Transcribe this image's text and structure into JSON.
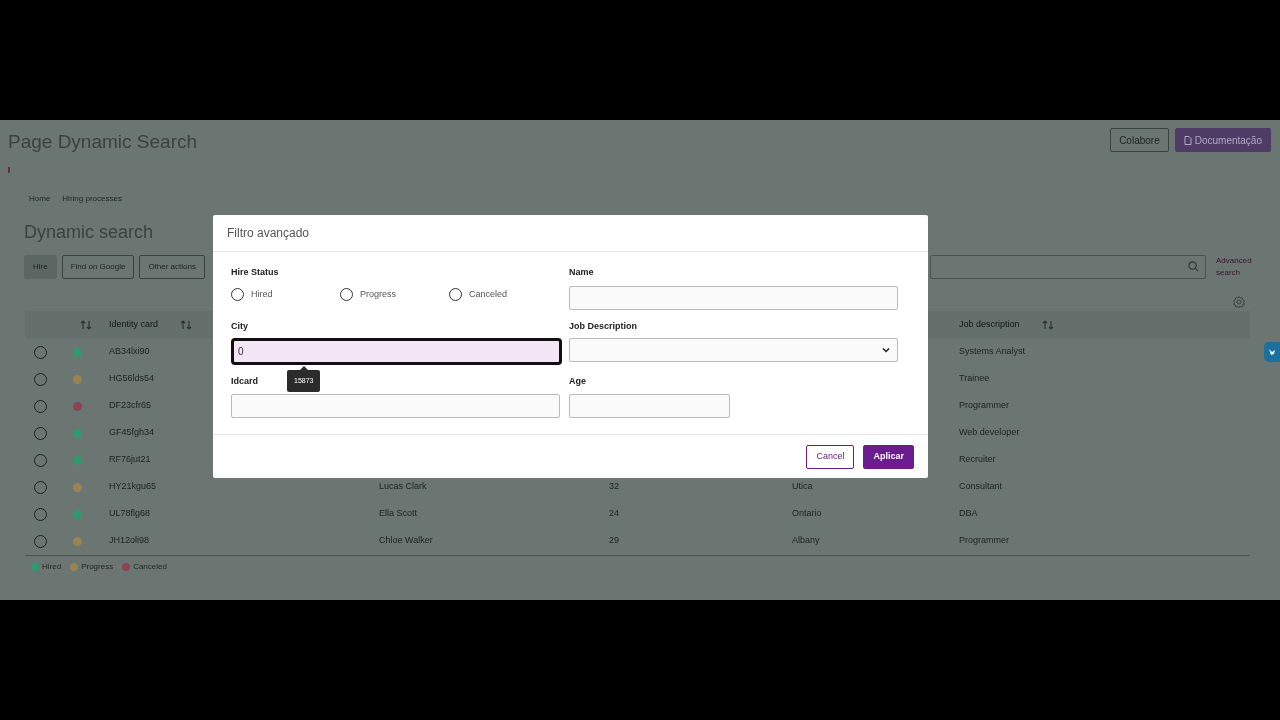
{
  "page": {
    "title": "Page Dynamic Search",
    "actions": [
      {
        "label": "Colabore",
        "kind": "outline"
      },
      {
        "label": "Documentação",
        "kind": "primary"
      }
    ]
  },
  "breadcrumb": [
    "Home",
    "Hiring processes"
  ],
  "heading": "Dynamic search",
  "toolbar": [
    {
      "label": "Hire",
      "kind": "filled"
    },
    {
      "label": "Find on Google",
      "kind": "outline"
    },
    {
      "label": "Other actions",
      "kind": "outline"
    }
  ],
  "advanced_search": "Advanced search",
  "table": {
    "columns": [
      {
        "label": "Identity card"
      },
      {
        "label": "Job description"
      }
    ],
    "rows": [
      {
        "selected": false,
        "id": "AB34lxi90",
        "job": "Systems Analyst",
        "color": "#2e9a70"
      },
      {
        "selected": false,
        "id": "HG56lds54",
        "job": "Trainee",
        "color": "#9a8350"
      },
      {
        "selected": false,
        "id": "DF23cfr65",
        "job": "Programmer",
        "color": "#8a4450"
      },
      {
        "selected": false,
        "id": "GF45fgh34",
        "job": "Web developer",
        "color": "#2e9a70"
      },
      {
        "selected": false,
        "id": "RF76jut21",
        "job": "Recruiter",
        "color": "#2e9a70"
      },
      {
        "selected": false,
        "id": "HY21kgu65",
        "name": "Lucas Clark",
        "age": "32",
        "city": "Utica",
        "job": "Consultant",
        "color": "#9a8350"
      },
      {
        "selected": false,
        "id": "UL78flg68",
        "name": "Ella Scott",
        "age": "24",
        "city": "Ontario",
        "job": "DBA",
        "color": "#2e9a70"
      },
      {
        "selected": false,
        "id": "JH12oli98",
        "name": "Chloe Walker",
        "age": "29",
        "city": "Albany",
        "job": "Programmer",
        "color": "#9a8350"
      }
    ]
  },
  "legend": [
    {
      "label": "Hired",
      "color": "#2e9a70"
    },
    {
      "label": "Progress",
      "color": "#9a8350"
    },
    {
      "label": "Canceled",
      "color": "#8a4450"
    }
  ],
  "dialog": {
    "title": "Filtro avançado",
    "hire_status": {
      "label": "Hire Status",
      "options": [
        {
          "label": "Hired",
          "selected": false
        },
        {
          "label": "Progress",
          "selected": false
        },
        {
          "label": "Canceled",
          "selected": false
        }
      ]
    },
    "name": {
      "label": "Name"
    },
    "city": {
      "label": "City",
      "value": "0",
      "focused": true,
      "tooltip": "15873"
    },
    "job": {
      "label": "Job Description"
    },
    "idcard": {
      "label": "Idcard"
    },
    "age": {
      "label": "Age"
    },
    "buttons": [
      {
        "label": "Cancel",
        "kind": "outline"
      },
      {
        "label": "Aplicar",
        "kind": "primary"
      }
    ]
  }
}
